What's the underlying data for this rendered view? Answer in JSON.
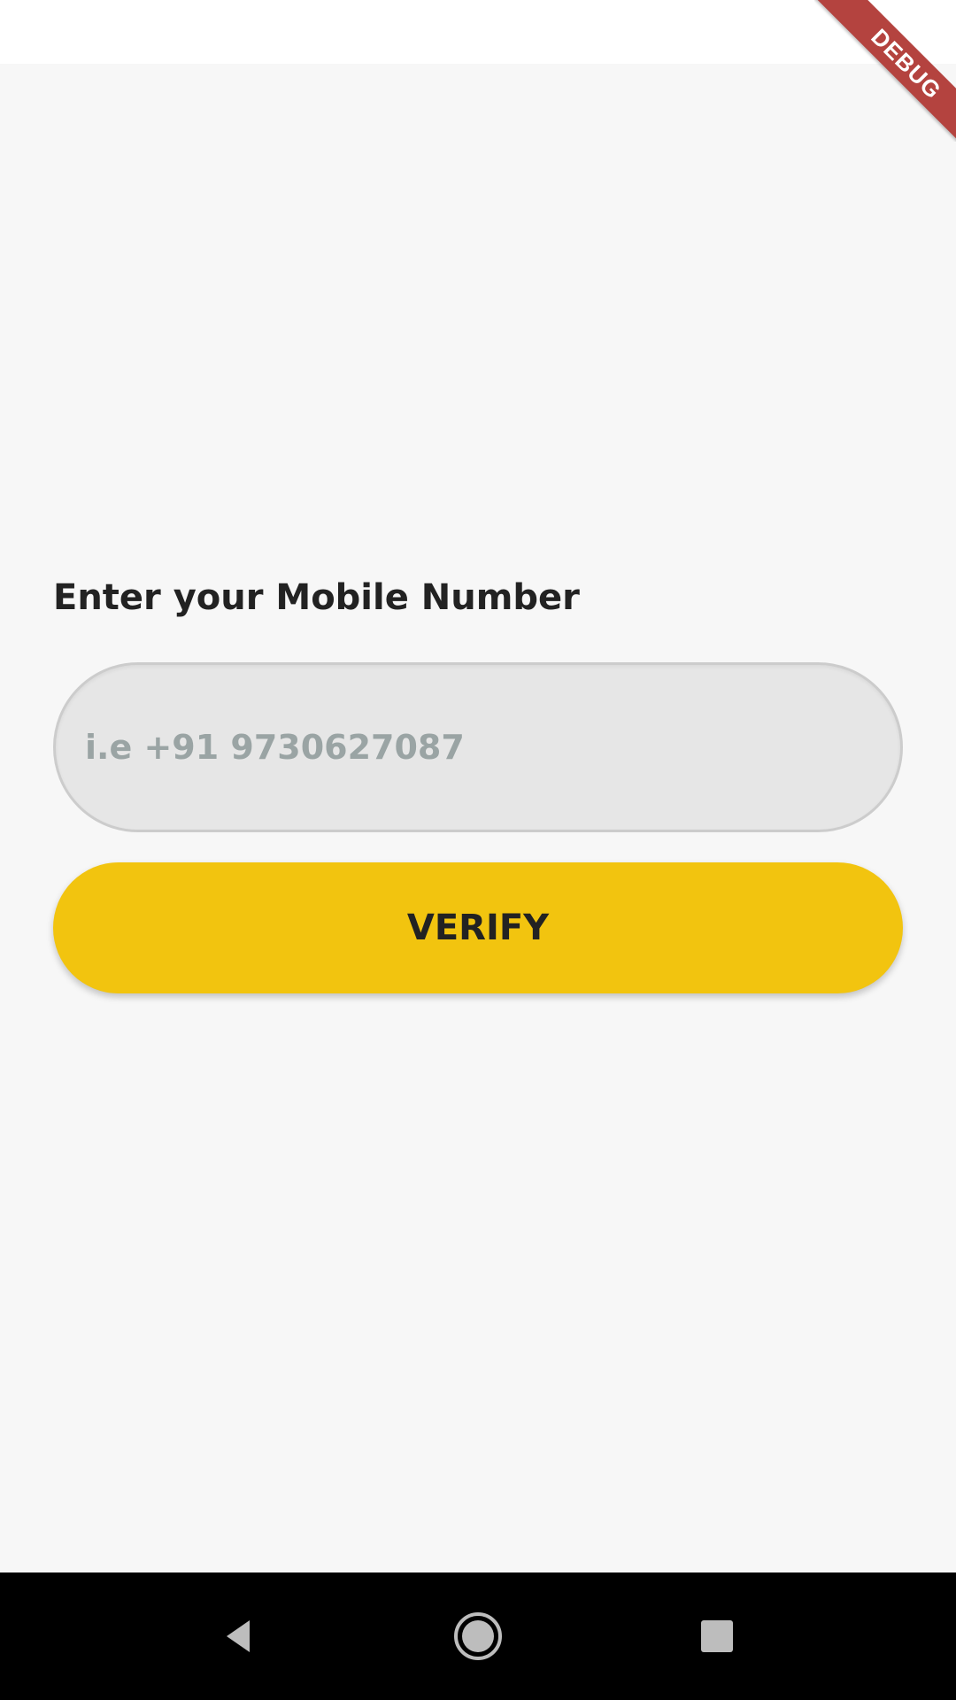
{
  "debug_banner": {
    "label": "DEBUG",
    "color": "#b4433f"
  },
  "login": {
    "title": "Enter your Mobile Number",
    "phone_input": {
      "placeholder": "i.e +91 9730627087",
      "value": ""
    },
    "verify_button_label": "VERIFY",
    "accent_color": "#f2c40f"
  },
  "navigation_bar": {
    "buttons": [
      {
        "icon": "back-triangle-icon"
      },
      {
        "icon": "home-circle-icon"
      },
      {
        "icon": "recents-square-icon"
      }
    ]
  }
}
